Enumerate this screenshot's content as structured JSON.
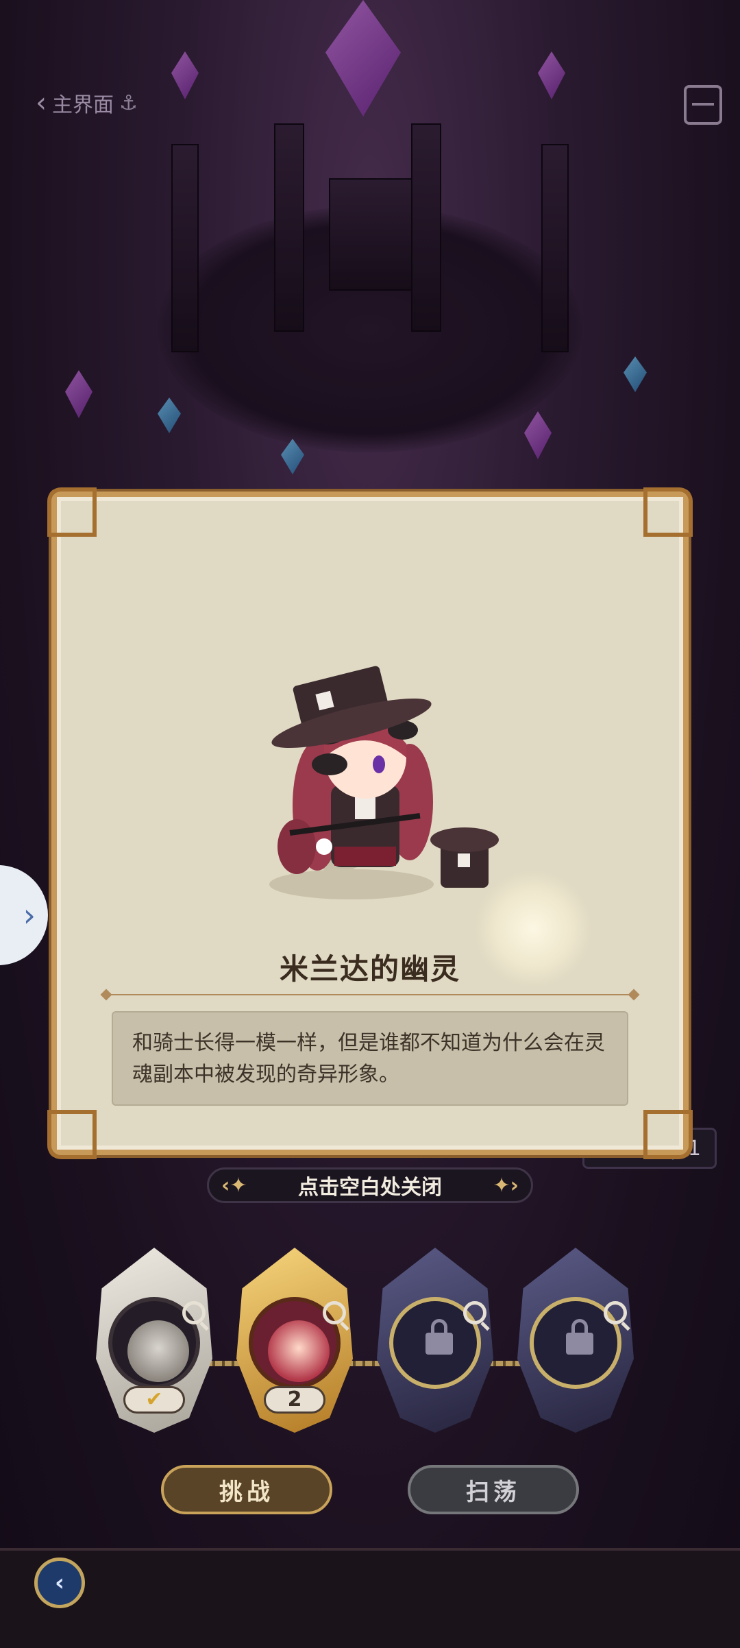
{
  "top_nav": {
    "back_label": "主界面",
    "anchor_icon": "anchor-icon",
    "chest_icon": "treasure-chest-icon"
  },
  "popup": {
    "character_name": "米兰达的幽灵",
    "description": "和骑士长得一模一样，但是谁都不知道为什么会在灵魂副本中被发现的奇异形象。"
  },
  "close_hint": "点击空白处关闭",
  "item_count": "1",
  "stages": [
    {
      "state": "cleared",
      "badge": "✔"
    },
    {
      "state": "current",
      "badge": "2"
    },
    {
      "state": "locked",
      "badge": ""
    },
    {
      "state": "locked",
      "badge": ""
    }
  ],
  "buttons": {
    "challenge": "挑战",
    "sweep": "扫荡"
  },
  "colors": {
    "card_bg": "#e0d9c3",
    "card_border": "#c89a5a",
    "background": "#2a1a2e",
    "crystal": "#b35cd6"
  }
}
